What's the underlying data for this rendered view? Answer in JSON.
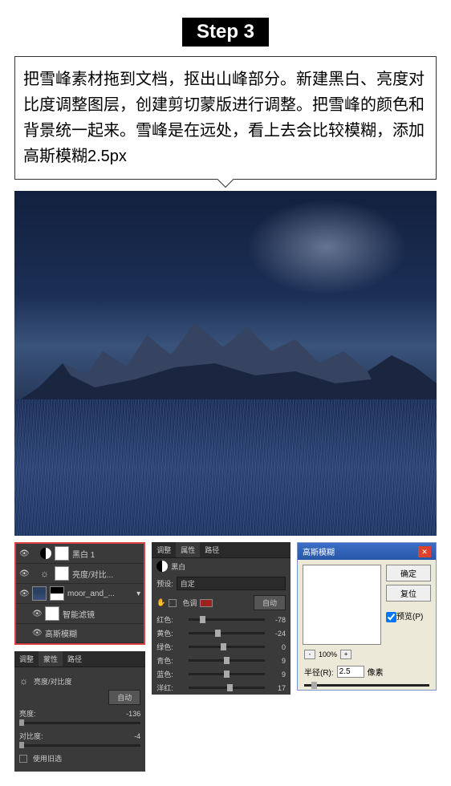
{
  "step": {
    "label": "Step 3"
  },
  "instruction": "把雪峰素材拖到文档，抠出山峰部分。新建黑白、亮度对比度调整图层，创建剪切蒙版进行调整。把雪峰的颜色和背景统一起来。雪峰是在远处，看上去会比较模糊，添加高斯模糊2.5px",
  "layers": {
    "items": [
      {
        "label": "黑白 1"
      },
      {
        "label": "亮度/对比..."
      },
      {
        "label": "moor_and_..."
      },
      {
        "label": "智能滤镜"
      },
      {
        "label": "高斯模糊"
      }
    ]
  },
  "brightness_panel": {
    "tabs": [
      "调整",
      "蒙性",
      "路径"
    ],
    "title": "亮度/对比度",
    "auto_btn": "自动",
    "brightness_label": "亮度:",
    "brightness_val": "-136",
    "contrast_label": "对比度:",
    "contrast_val": "-4",
    "legacy": "使用旧选"
  },
  "bw_panel": {
    "tabs": [
      "调整",
      "属性",
      "路径"
    ],
    "icon_label": "黑白",
    "preset_label": "预设:",
    "preset_val": "自定",
    "tone_label": "色调",
    "auto_btn": "自动",
    "sliders": [
      {
        "label": "红色:",
        "val": "-78",
        "pos": 15
      },
      {
        "label": "黄色:",
        "val": "-24",
        "pos": 35
      },
      {
        "label": "绿色:",
        "val": "0",
        "pos": 42
      },
      {
        "label": "青色:",
        "val": "9",
        "pos": 46
      },
      {
        "label": "蓝色:",
        "val": "9",
        "pos": 46
      },
      {
        "label": "洋红:",
        "val": "17",
        "pos": 50
      }
    ]
  },
  "gaussian_dialog": {
    "title": "高斯模糊",
    "ok": "确定",
    "cancel": "复位",
    "preview_chk": "预览(P)",
    "zoom": "100%",
    "radius_label": "半径(R):",
    "radius_val": "2.5",
    "radius_unit": "像素"
  }
}
